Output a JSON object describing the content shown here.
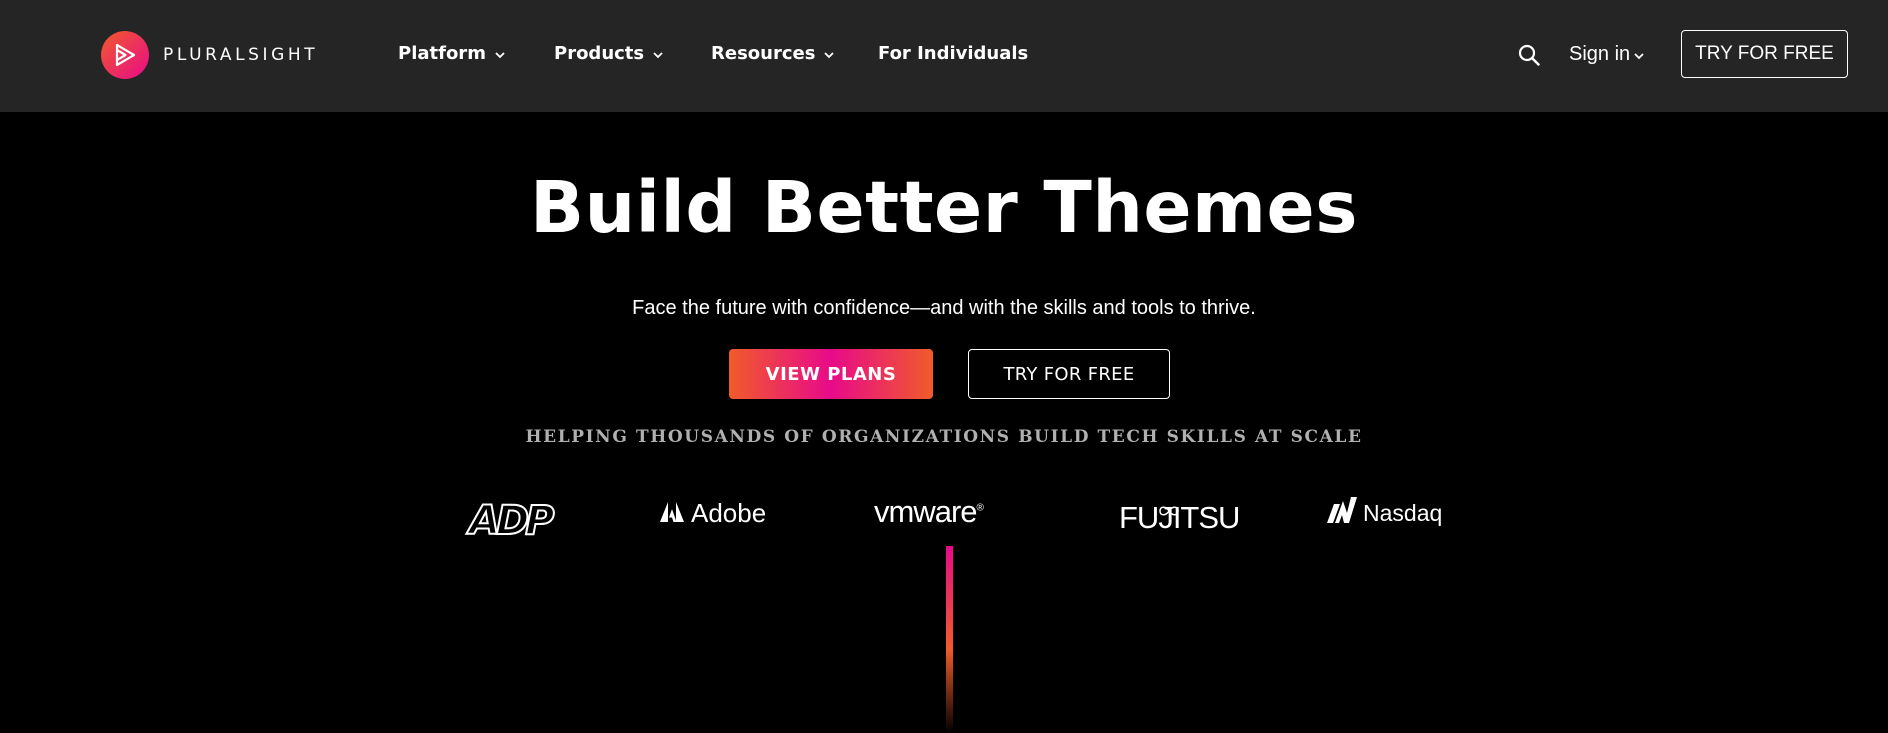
{
  "header": {
    "brand": "PLURALSIGHT",
    "nav": [
      {
        "label": "Platform",
        "has_dropdown": true
      },
      {
        "label": "Products",
        "has_dropdown": true
      },
      {
        "label": "Resources",
        "has_dropdown": true
      },
      {
        "label": "For Individuals",
        "has_dropdown": false
      }
    ],
    "search_icon": "search-icon",
    "sign_in": "Sign in",
    "cta": "TRY FOR FREE"
  },
  "hero": {
    "title": "Build Better Themes",
    "subtitle": "Face the future with confidence—and with the skills and tools to thrive.",
    "primary_button": "VIEW PLANS",
    "secondary_button": "TRY FOR FREE"
  },
  "customers": {
    "tagline": "HELPING THOUSANDS OF ORGANIZATIONS BUILD TECH SKILLS AT SCALE",
    "logos": [
      "ADP",
      "Adobe",
      "vmware",
      "FUJITSU",
      "Nasdaq"
    ]
  },
  "colors": {
    "nav_bg": "#252525",
    "page_bg": "#000000",
    "brand_orange": "#f15b2a",
    "brand_pink": "#e80a89"
  }
}
